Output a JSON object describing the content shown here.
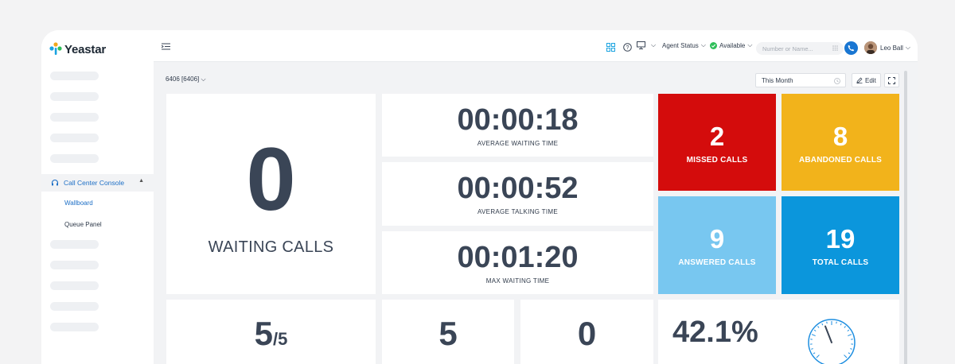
{
  "app": {
    "brand": "Yeastar"
  },
  "sidebar": {
    "section": {
      "label": "Call Center Console",
      "icon": "headset-icon",
      "expanded": true
    },
    "items": [
      {
        "label": "Wallboard",
        "active": true
      },
      {
        "label": "Queue Panel",
        "active": false
      }
    ]
  },
  "topbar": {
    "agent_status_label": "Agent Status",
    "availability_label": "Available",
    "availability_color": "#2fbf5a",
    "search_placeholder": "Number or Name...",
    "user_name": "Leo Ball"
  },
  "toolbar": {
    "queue_select": "6406 [6406]",
    "date_range": "This Month",
    "edit_label": "Edit"
  },
  "wallboard": {
    "waiting_calls": {
      "value": "0",
      "label": "WAITING CALLS"
    },
    "avg_waiting": {
      "value": "00:00:18",
      "label": "AVERAGE WAITING TIME"
    },
    "avg_talking": {
      "value": "00:00:52",
      "label": "AVERAGE TALKING TIME"
    },
    "max_waiting": {
      "value": "00:01:20",
      "label": "MAX WAITING TIME"
    },
    "missed": {
      "value": "2",
      "label": "MISSED CALLS",
      "color": "#d40c0c"
    },
    "abandoned": {
      "value": "8",
      "label": "ABANDONED CALLS",
      "color": "#f2b31b"
    },
    "answered": {
      "value": "9",
      "label": "ANSWERED CALLS",
      "color": "#78c7f0"
    },
    "total": {
      "value": "19",
      "label": "TOTAL CALLS",
      "color": "#0b96dc"
    },
    "agents": {
      "value": "5",
      "total": "/5"
    },
    "stat_a": {
      "value": "5"
    },
    "stat_b": {
      "value": "0"
    },
    "rate": {
      "value": "42.1%",
      "gauge_level": 0.421
    }
  }
}
